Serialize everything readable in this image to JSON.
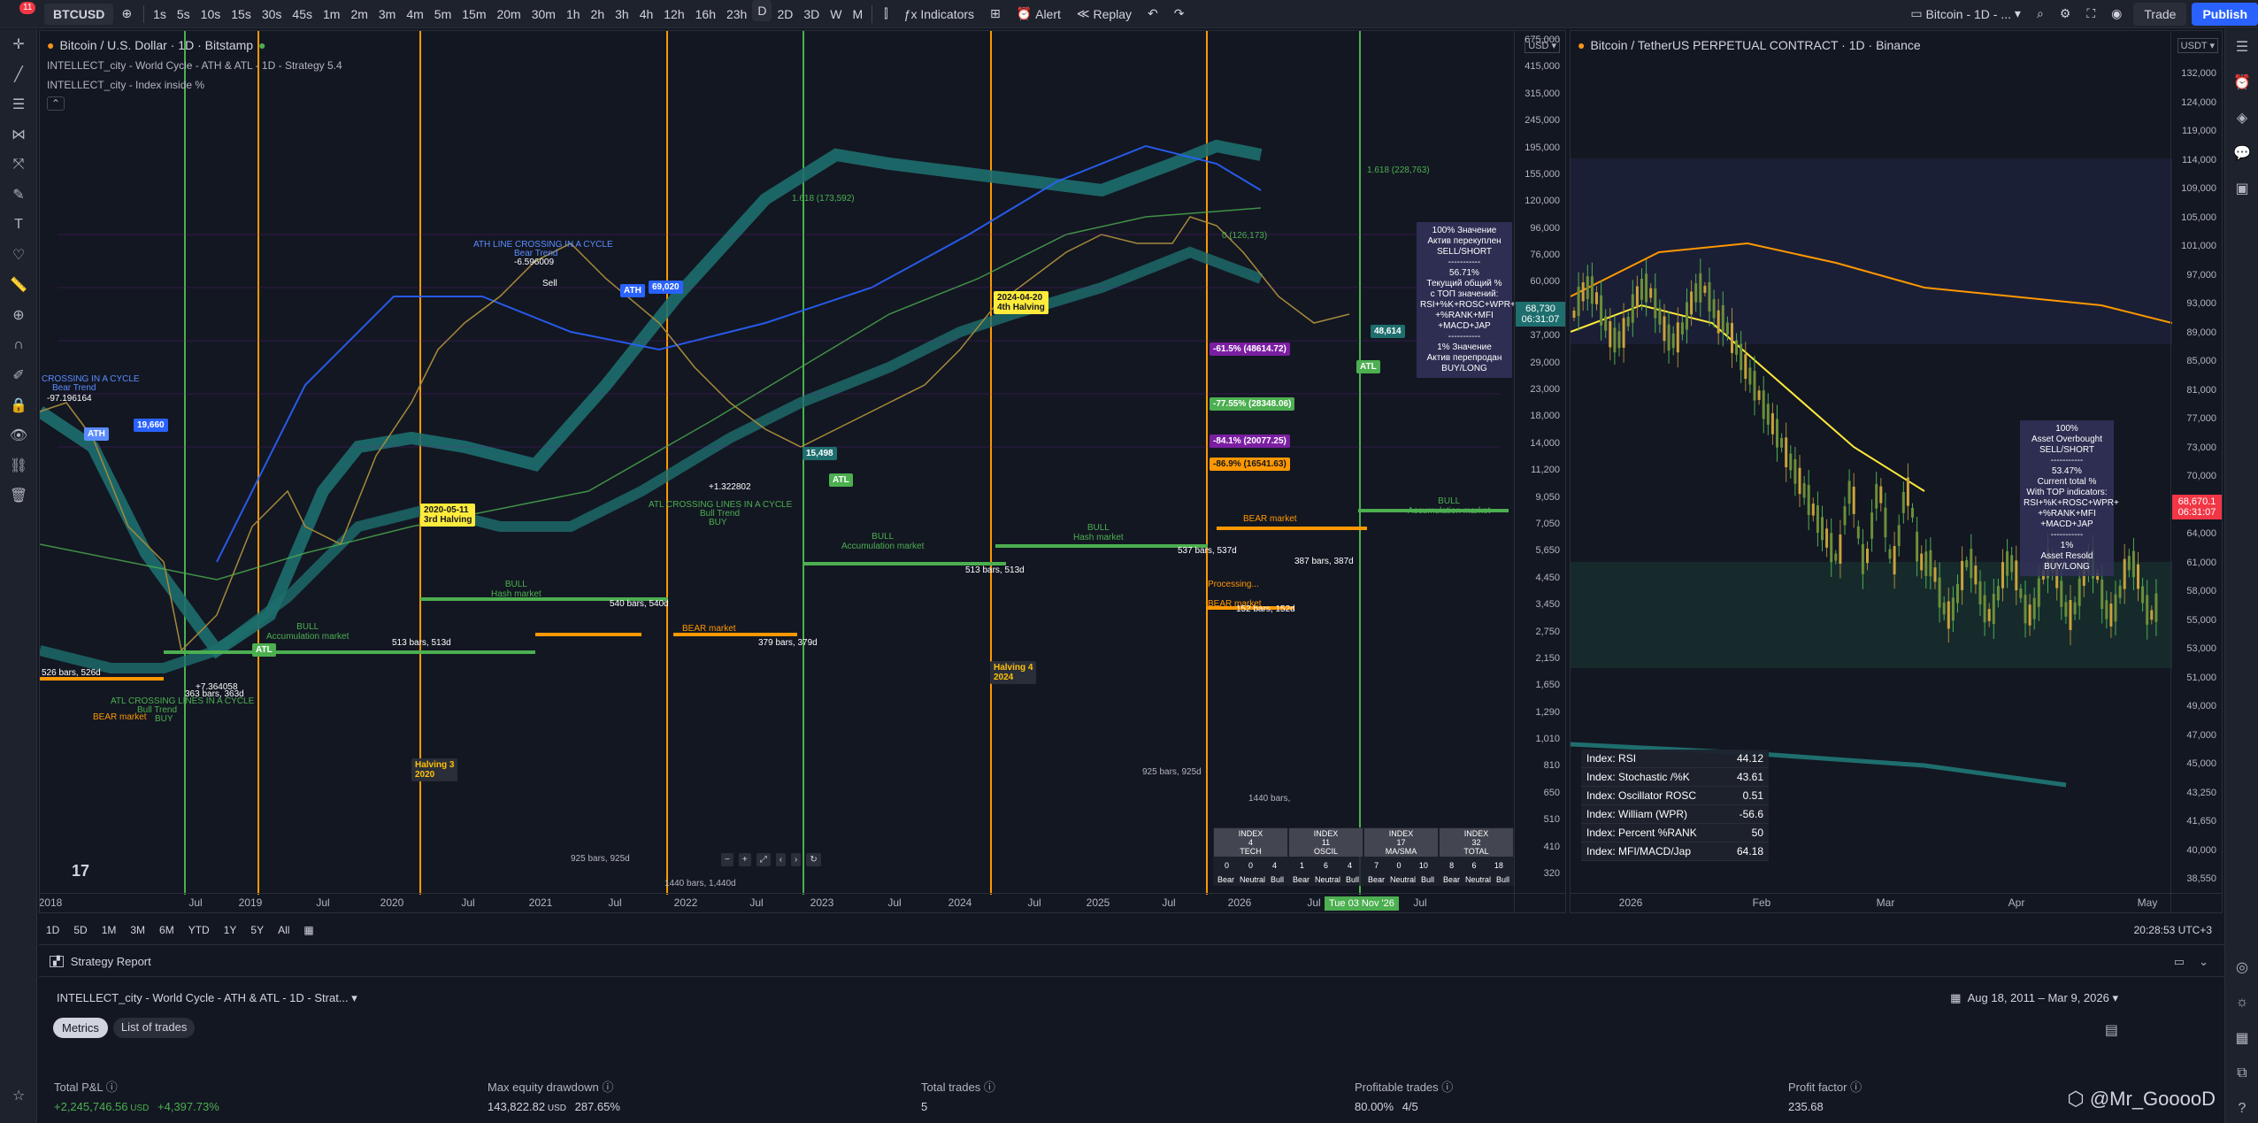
{
  "topbar": {
    "symbol": "BTCUSD",
    "intervals": [
      "1s",
      "5s",
      "10s",
      "15s",
      "30s",
      "45s",
      "1m",
      "2m",
      "3m",
      "4m",
      "5m",
      "15m",
      "20m",
      "30m",
      "1h",
      "2h",
      "3h",
      "4h",
      "12h",
      "16h",
      "23h",
      "D",
      "2D",
      "3D",
      "W",
      "M"
    ],
    "active_interval": "D",
    "indicators": "Indicators",
    "alert": "Alert",
    "replay": "Replay",
    "layout": "Bitcoin - 1D - ...",
    "trade": "Trade",
    "publish": "Publish",
    "notif_count": "11"
  },
  "pane1": {
    "title": "Bitcoin / U.S. Dollar · 1D · Bitstamp",
    "ind1": "INTELLECT_city - World Cycle - ATH & ATL - 1D - Strategy 5.4",
    "ind2": "INTELLECT_city - Index inside %",
    "currency": "USD",
    "price": "68,730",
    "countdown": "06:31:07",
    "yticks": [
      "675,000",
      "415,000",
      "315,000",
      "245,000",
      "195,000",
      "155,000",
      "120,000",
      "96,000",
      "76,000",
      "60,000",
      "47,000",
      "37,000",
      "29,000",
      "23,000",
      "18,000",
      "14,000",
      "11,200",
      "9,050",
      "7,050",
      "5,650",
      "4,450",
      "3,450",
      "2,750",
      "2,150",
      "1,650",
      "1,290",
      "1,010",
      "810",
      "650",
      "510",
      "410",
      "320"
    ],
    "xticks": [
      "2018",
      "Jul",
      "2019",
      "Jul",
      "2020",
      "Jul",
      "2021",
      "Jul",
      "2022",
      "Jul",
      "2023",
      "Jul",
      "2024",
      "Jul",
      "2025",
      "Jul",
      "2026",
      "Jul",
      "Jul"
    ],
    "date_badge": "Tue 03 Nov '26",
    "labels": {
      "crossing_top": "CROSSING IN A CYCLE",
      "bear_trend_a": "Bear Trend",
      "val_a": "-97.196164",
      "ath1": "ATH",
      "val_19660": "19,660",
      "ath_line": "ATH LINE CROSSING IN A CYCLE",
      "bear_trend_b": "Bear Trend",
      "val_b": "-6.596009",
      "sell": "Sell",
      "ath2": "ATH",
      "val_69020": "69,020",
      "atl_cross": "ATL CROSSING LINES IN A CYCLE",
      "bull_trend": "Bull Trend",
      "buy": "BUY",
      "atl_cross2": "ATL CROSSING LINES IN A CYCLE",
      "val_c": "+1.322802",
      "atl2": "ATL",
      "val_15498": "15,498",
      "val_d": "+7.364058",
      "atl1": "ATL",
      "halving3": "Halving 3\n2020",
      "halving4": "Halving 4\n2024",
      "h2024": "2024-04-20\n4th Halving",
      "h2020": "2020-05-11\n3rd Halving",
      "bull_hash1": "BULL\nHash market",
      "bull_acc1": "BULL\nAccumulation market",
      "bear_mkt1": "BEAR market",
      "bear_mkt2": "BEAR market",
      "bull_acc2": "BULL\nAccumulation market",
      "bull_hash2": "BULL\nHash market",
      "bear_mkt3": "BEAR market",
      "bull_acc3": "BULL\nAccumulation market",
      "processing": "Processing...",
      "bear_mkt4": "BEAR market",
      "bars_526": "526 bars, 526d",
      "bars_363": "363 bars, 363d",
      "bars_513a": "513 bars, 513d",
      "bars_540": "540 bars, 540d",
      "bars_379": "379 bars, 379d",
      "bars_513b": "513 bars, 513d",
      "bars_537": "537 bars, 537d",
      "bars_387": "387 bars, 387d",
      "bars_152": "152 bars, 152d",
      "bars_925a": "925 bars, 925d",
      "bars_1440a": "1440 bars, 1,440d",
      "bars_925b": "925 bars, 925d",
      "bars_1440b": "1440 bars,",
      "pct_615": "-61.5% (48614.72)",
      "pct_7755": "-77.55% (28348.06)",
      "pct_841": "-84.1% (20077.25)",
      "pct_869": "-86.9% (16541.63)",
      "fib0": "0 (126,173)",
      "fib_top": "1.618 (228,763)",
      "fib_mid": "1.618 (173,592)",
      "v48614": "48,614",
      "atl3": "ATL"
    },
    "infobox": {
      "l1": "100% Значение",
      "l2": "Актив перекуплен",
      "l3": "SELL/SHORT",
      "l4": "-----------",
      "l5": "56.71%",
      "l6": "Текущий общий %",
      "l7": "с ТОП значений:",
      "l8": "RSI+%K+ROSC+WPR+",
      "l9": "+%RANK+MFI",
      "l10": "+MACD+JAP",
      "l11": "-----------",
      "l12": "1% Значение",
      "l13": "Актив перепродан",
      "l14": "BUY/LONG"
    },
    "summary": {
      "cols": [
        {
          "name": "INDEX\n4\nTECH",
          "vals": [
            "0",
            "0",
            "4"
          ]
        },
        {
          "name": "INDEX\n11\nOSCIL",
          "vals": [
            "1",
            "6",
            "4"
          ]
        },
        {
          "name": "INDEX\n17\nMA/SMA",
          "vals": [
            "7",
            "0",
            "10"
          ]
        },
        {
          "name": "INDEX\n32\nTOTAL",
          "vals": [
            "8",
            "6",
            "18"
          ]
        }
      ],
      "sub": [
        "Bear",
        "Neutral",
        "Bull"
      ]
    }
  },
  "pane2": {
    "title": "Bitcoin / TetherUS PERPETUAL CONTRACT · 1D · Binance",
    "currency": "USDT",
    "price": "68,670.1",
    "countdown": "06:31:07",
    "yticks": [
      "132,000",
      "124,000",
      "119,000",
      "114,000",
      "109,000",
      "105,000",
      "101,000",
      "97,000",
      "93,000",
      "89,000",
      "85,000",
      "81,000",
      "77,000",
      "73,000",
      "70,000",
      "67,000",
      "64,000",
      "61,000",
      "58,000",
      "55,000",
      "53,000",
      "51,000",
      "49,000",
      "47,000",
      "45,000",
      "43,250",
      "41,650",
      "40,000",
      "38,550"
    ],
    "xticks": [
      "2026",
      "Feb",
      "Mar",
      "Apr",
      "May"
    ],
    "infobox": {
      "l1": "100%",
      "l2": "Asset Overbought",
      "l3": "SELL/SHORT",
      "l4": "-----------",
      "l5": "53.47%",
      "l6": "Current total %",
      "l7": "With TOP indicators:",
      "l8": "RSI+%K+ROSC+WPR+",
      "l9": "+%RANK+MFI",
      "l10": "+MACD+JAP",
      "l11": "-----------",
      "l12": "1%",
      "l13": "Asset Resold",
      "l14": "BUY/LONG"
    },
    "index_table": [
      {
        "k": "Index: RSI",
        "v": "44.12"
      },
      {
        "k": "Index: Stochastic /%K",
        "v": "43.61"
      },
      {
        "k": "Index: Oscillator ROSC",
        "v": "0.51"
      },
      {
        "k": "Index: William (WPR)",
        "v": "-56.6"
      },
      {
        "k": "Index: Percent %RANK",
        "v": "50"
      },
      {
        "k": "Index: MFI/MACD/Jap",
        "v": "64.18"
      }
    ]
  },
  "timeframes": [
    "1D",
    "5D",
    "1M",
    "3M",
    "6M",
    "YTD",
    "1Y",
    "5Y",
    "All"
  ],
  "clock": "20:28:53 UTC+3",
  "strategy": {
    "title": "Strategy Report",
    "name": "INTELLECT_city - World Cycle - ATH & ATL - 1D - Strat...",
    "date_range": "Aug 18, 2011 – Mar 9, 2026",
    "tabs": [
      "Metrics",
      "List of trades"
    ],
    "metrics": [
      {
        "name": "Total P&L",
        "val": "+2,245,746.56",
        "unit": "USD",
        "pct": "+4,397.73%"
      },
      {
        "name": "Max equity drawdown",
        "val": "143,822.82",
        "unit": "USD",
        "pct": "287.65%"
      },
      {
        "name": "Total trades",
        "val": "5",
        "unit": "",
        "pct": ""
      },
      {
        "name": "Profitable trades",
        "val": "80.00%",
        "unit": "",
        "pct": "4/5"
      },
      {
        "name": "Profit factor",
        "val": "235.68",
        "unit": "",
        "pct": ""
      }
    ]
  },
  "watermark": "@Mr_GooooD",
  "colors": {
    "green": "#4caf50",
    "orange": "#ff9800",
    "teal": "#1e6e6e",
    "blue": "#2962ff",
    "purple": "#7b1fa2",
    "red": "#f23645"
  }
}
